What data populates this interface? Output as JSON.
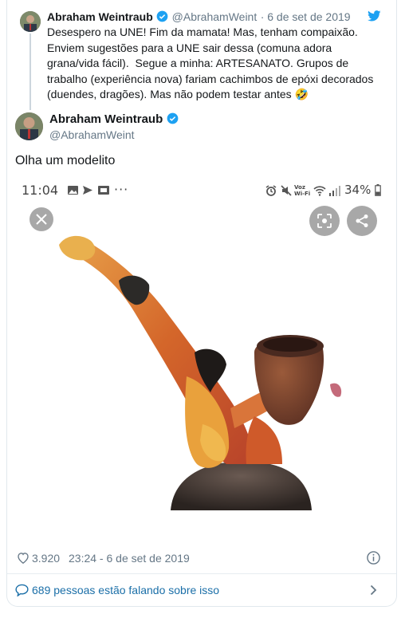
{
  "quoted": {
    "name": "Abraham Weintraub",
    "handle": "@AbrahamWeint",
    "date": "· 6 de set de 2019",
    "text": "Desespero na UNE! Fim da mamata! Mas, tenham compaixão.\nEnviem sugestões para a UNE sair dessa (comuna adora\ngrana/vida fácil).  Segue a minha: ARTESANATO. Grupos de\ntrabalho (experiência nova) fariam cachimbos de epóxi decorados\n(duendes, dragões). Mas não podem testar antes",
    "emoji": "🤣"
  },
  "main": {
    "name": "Abraham Weintraub",
    "handle": "@AbrahamWeint",
    "text": "Olha um modelito"
  },
  "phone": {
    "time": "11:04",
    "more": "···",
    "volte": "Voz\nWi-Fi",
    "battery": "34%"
  },
  "footer": {
    "likes": "3.920",
    "timestamp": "23:24 - 6 de set de 2019",
    "talking": "689 pessoas estão falando sobre isso"
  },
  "colors": {
    "twitter_blue": "#1da1f2",
    "link_blue": "#1b6fa8",
    "muted": "#657786"
  },
  "icons": [
    "twitter-bird-icon",
    "verified-badge-icon",
    "heart-icon",
    "info-icon",
    "speech-bubble-icon",
    "chevron-right-icon",
    "close-icon",
    "lens-icon",
    "share-icon"
  ]
}
